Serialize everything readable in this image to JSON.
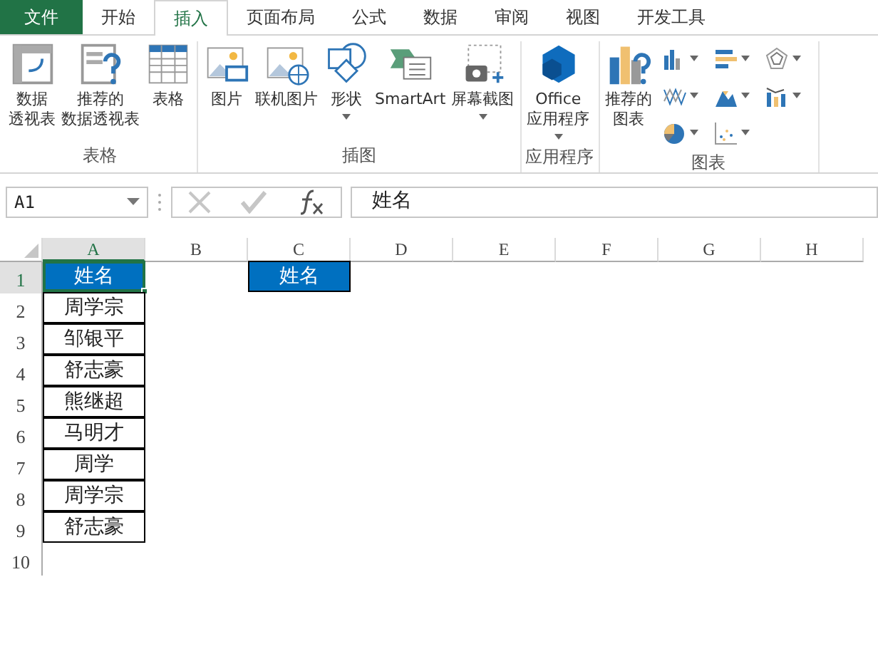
{
  "tabs": [
    {
      "label": "文件",
      "kind": "file",
      "selected": false
    },
    {
      "label": "开始",
      "kind": "tab",
      "selected": false
    },
    {
      "label": "插入",
      "kind": "tab",
      "selected": true
    },
    {
      "label": "页面布局",
      "kind": "tab",
      "selected": false
    },
    {
      "label": "公式",
      "kind": "tab",
      "selected": false
    },
    {
      "label": "数据",
      "kind": "tab",
      "selected": false
    },
    {
      "label": "审阅",
      "kind": "tab",
      "selected": false
    },
    {
      "label": "视图",
      "kind": "tab",
      "selected": false
    },
    {
      "label": "开发工具",
      "kind": "tab",
      "selected": false
    }
  ],
  "ribbon_groups": [
    {
      "label": "表格",
      "buttons": [
        {
          "lines": [
            "数据",
            "透视表"
          ],
          "dropdown": false
        },
        {
          "lines": [
            "推荐的",
            "数据透视表"
          ],
          "dropdown": false
        },
        {
          "lines": [
            "表格"
          ],
          "dropdown": false
        }
      ]
    },
    {
      "label": "插图",
      "buttons": [
        {
          "lines": [
            "图片"
          ],
          "dropdown": false
        },
        {
          "lines": [
            "联机图片"
          ],
          "dropdown": false
        },
        {
          "lines": [
            "形状"
          ],
          "dropdown": true
        },
        {
          "lines": [
            "SmartArt"
          ],
          "dropdown": false
        },
        {
          "lines": [
            "屏幕截图"
          ],
          "dropdown": true
        }
      ]
    },
    {
      "label": "应用程序",
      "buttons": [
        {
          "lines": [
            "Office",
            "应用程序"
          ],
          "dropdown": true
        }
      ]
    },
    {
      "label": "图表",
      "buttons": [
        {
          "lines": [
            "推荐的",
            "图表"
          ],
          "dropdown": false
        }
      ],
      "small_icons": true
    }
  ],
  "name_box": "A1",
  "formula": "姓名",
  "columns": [
    {
      "label": "A",
      "selected": true
    },
    {
      "label": "B",
      "selected": false
    },
    {
      "label": "C",
      "selected": false
    },
    {
      "label": "D",
      "selected": false
    },
    {
      "label": "E",
      "selected": false
    },
    {
      "label": "F",
      "selected": false
    },
    {
      "label": "G",
      "selected": false
    },
    {
      "label": "H",
      "selected": false
    }
  ],
  "rows": [
    {
      "header": "1",
      "selected": true,
      "a": {
        "text": "姓名",
        "highlighted": true,
        "selected": true
      },
      "c": {
        "text": "姓名",
        "highlighted": true,
        "selected": false
      }
    },
    {
      "header": "2",
      "selected": false,
      "a": {
        "text": "周学宗",
        "highlighted": false,
        "selected": false
      }
    },
    {
      "header": "3",
      "selected": false,
      "a": {
        "text": "邹银平",
        "highlighted": false,
        "selected": false
      }
    },
    {
      "header": "4",
      "selected": false,
      "a": {
        "text": "舒志豪",
        "highlighted": false,
        "selected": false
      }
    },
    {
      "header": "5",
      "selected": false,
      "a": {
        "text": "熊继超",
        "highlighted": false,
        "selected": false
      }
    },
    {
      "header": "6",
      "selected": false,
      "a": {
        "text": "马明才",
        "highlighted": false,
        "selected": false
      }
    },
    {
      "header": "7",
      "selected": false,
      "a": {
        "text": "周学",
        "highlighted": false,
        "selected": false
      }
    },
    {
      "header": "8",
      "selected": false,
      "a": {
        "text": "周学宗",
        "highlighted": false,
        "selected": false
      }
    },
    {
      "header": "9",
      "selected": false,
      "a": {
        "text": "舒志豪",
        "highlighted": false,
        "selected": false
      }
    },
    {
      "header": "10",
      "selected": false
    }
  ]
}
